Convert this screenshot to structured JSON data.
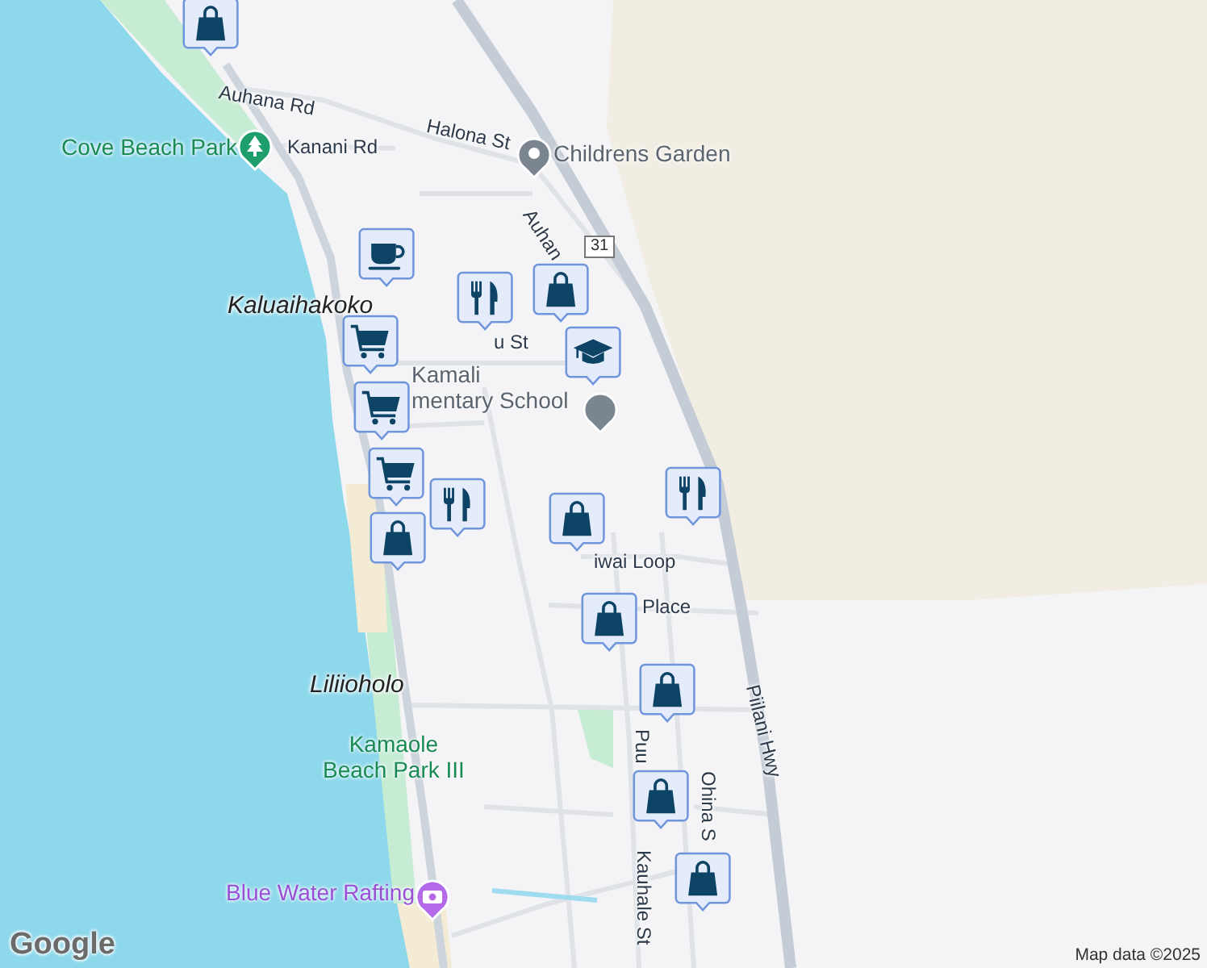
{
  "map": {
    "labels": [
      {
        "text": "Auhana Rd",
        "kind": "street"
      },
      {
        "text": "Kanani Rd",
        "kind": "street"
      },
      {
        "text": "Halona St",
        "kind": "street"
      },
      {
        "text": "Auhan",
        "kind": "street"
      },
      {
        "text": "Kaluaihakoko",
        "kind": "locality"
      },
      {
        "text": "u St",
        "kind": "street"
      },
      {
        "text": "iwai Loop",
        "kind": "street"
      },
      {
        "text": "Place",
        "kind": "street"
      },
      {
        "text": "Liliioholo",
        "kind": "locality"
      },
      {
        "text": "Puu",
        "kind": "street"
      },
      {
        "text": "Ohina S",
        "kind": "street"
      },
      {
        "text": "Kauhale St",
        "kind": "street"
      },
      {
        "text": "Piilani Hwy",
        "kind": "highway"
      }
    ],
    "route_shield": "31",
    "pois": [
      {
        "lines": [
          "Cove Beach Park"
        ],
        "kind": "park"
      },
      {
        "lines": [
          "Childrens Garden"
        ],
        "kind": "place"
      },
      {
        "lines": [
          "Kamali",
          "mentary School"
        ],
        "kind": "school"
      },
      {
        "lines": [
          "Kamaole",
          "Beach Park III"
        ],
        "kind": "park-text"
      },
      {
        "lines": [
          "Blue Water Rafting"
        ],
        "kind": "activity"
      }
    ],
    "markers": [
      {
        "kind": "shopping"
      },
      {
        "kind": "cafe"
      },
      {
        "kind": "restaurant"
      },
      {
        "kind": "shopping"
      },
      {
        "kind": "grocery"
      },
      {
        "kind": "school"
      },
      {
        "kind": "grocery"
      },
      {
        "kind": "grocery"
      },
      {
        "kind": "restaurant"
      },
      {
        "kind": "shopping"
      },
      {
        "kind": "shopping"
      },
      {
        "kind": "restaurant"
      },
      {
        "kind": "shopping"
      },
      {
        "kind": "shopping"
      },
      {
        "kind": "shopping"
      },
      {
        "kind": "shopping"
      }
    ]
  },
  "attribution": {
    "logo": "Google",
    "text": "Map data ©2025"
  }
}
